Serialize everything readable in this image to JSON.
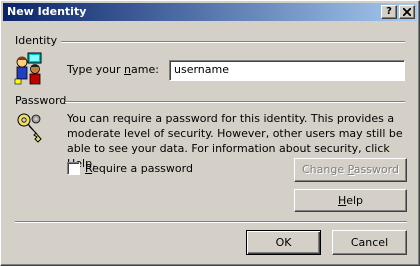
{
  "window": {
    "title": "New Identity",
    "help_glyph": "?",
    "titlebar_gradient": [
      "#0a246a",
      "#a6caf0"
    ],
    "face_color": "#d4d0c8"
  },
  "identity": {
    "group_label": "Identity",
    "name_label_prefix": "Type your ",
    "name_label_accel": "n",
    "name_label_suffix": "ame:",
    "name_value": "username"
  },
  "password": {
    "group_label": "Password",
    "description": "You can require a password for this identity.  This provides a moderate level of security. However, other users may still be able to see your data. For information about security, click Help.",
    "checkbox_accel": "R",
    "checkbox_label_rest": "equire a password",
    "checkbox_checked": false,
    "change_button_prefix": "Change ",
    "change_button_accel": "P",
    "change_button_suffix": "assword",
    "change_button_enabled": false
  },
  "buttons": {
    "help_accel": "H",
    "help_rest": "elp",
    "ok": "OK",
    "cancel": "Cancel"
  },
  "icons": {
    "identity": "identity-people-icon",
    "key": "key-icon",
    "help": "help-question-icon",
    "close": "close-icon"
  }
}
